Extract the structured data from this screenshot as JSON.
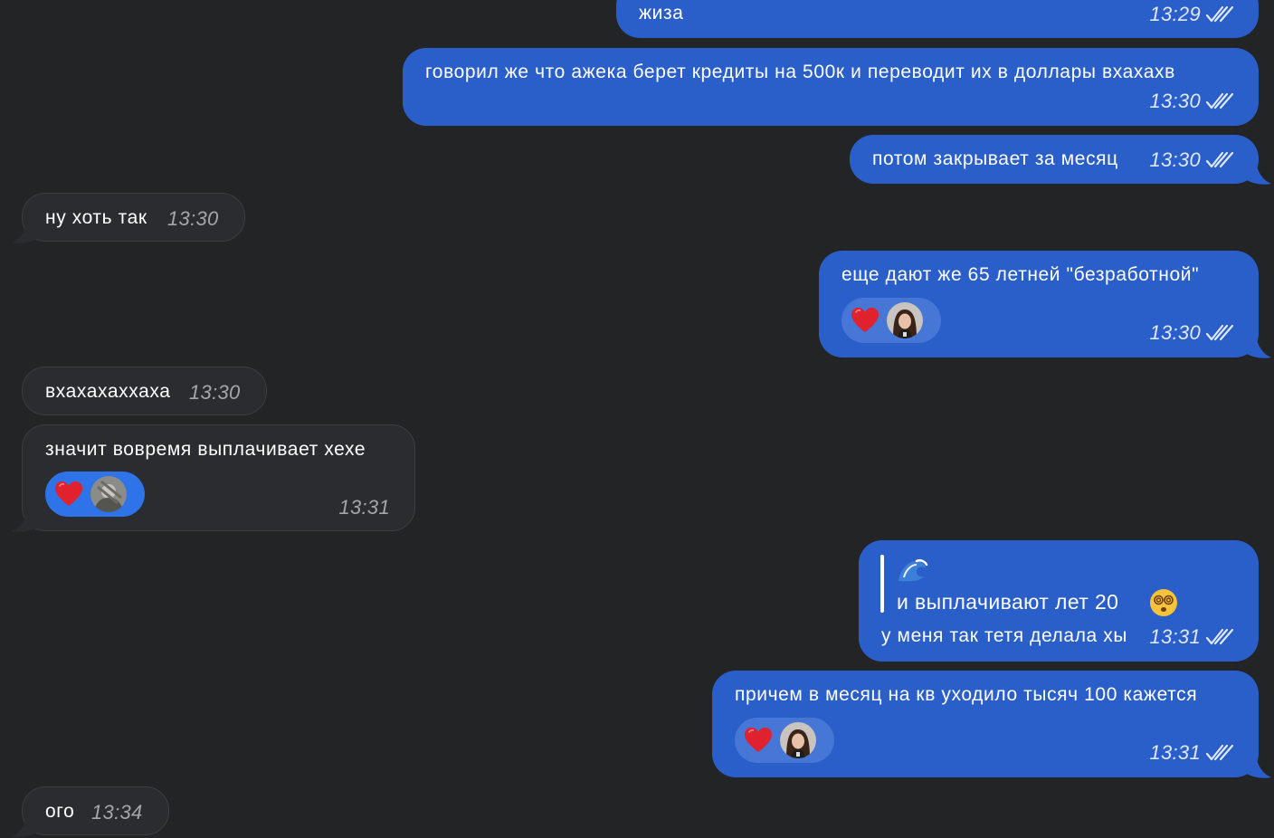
{
  "messages": [
    {
      "id": "m1",
      "dir": "out",
      "text": "жиза",
      "time": "13:29"
    },
    {
      "id": "m2",
      "dir": "out",
      "text": "говорил же что ажека берет кредиты на 500к и переводит их в доллары вхахахв",
      "time": "13:30"
    },
    {
      "id": "m3",
      "dir": "out",
      "text": "потом закрывает за месяц",
      "time": "13:30"
    },
    {
      "id": "m4",
      "dir": "in",
      "text": "ну хоть так",
      "time": "13:30"
    },
    {
      "id": "m5",
      "dir": "out",
      "text": "еще дают же 65 летней \"безработной\"",
      "time": "13:30",
      "reaction": "heart"
    },
    {
      "id": "m6",
      "dir": "in",
      "text": "вхахахаххаха",
      "time": "13:30"
    },
    {
      "id": "m7",
      "dir": "in",
      "text": "значит вовремя выплачивает хехе",
      "time": "13:31",
      "reaction": "heart"
    },
    {
      "id": "m8",
      "dir": "out",
      "quote": "и выплачивают лет 20",
      "text": "у меня так тетя делала хы",
      "time": "13:31"
    },
    {
      "id": "m9",
      "dir": "out",
      "text": "причем в месяц на кв уходило тысяч 100 кажется",
      "time": "13:31",
      "reaction": "heart"
    },
    {
      "id": "m10",
      "dir": "in",
      "text": "ого",
      "time": "13:34"
    }
  ],
  "colors": {
    "background": "#222426",
    "outgoing_bubble": "#2a5fc9",
    "incoming_bubble": "#2a2c2f",
    "reaction_heart": "#e0212e"
  },
  "icons": {
    "read_status": "double-check-icon",
    "reaction": "heart-icon",
    "quote_emoji": "wave-emoji-icon",
    "dizzy_emoji": "dizzy-face-emoji-icon"
  }
}
